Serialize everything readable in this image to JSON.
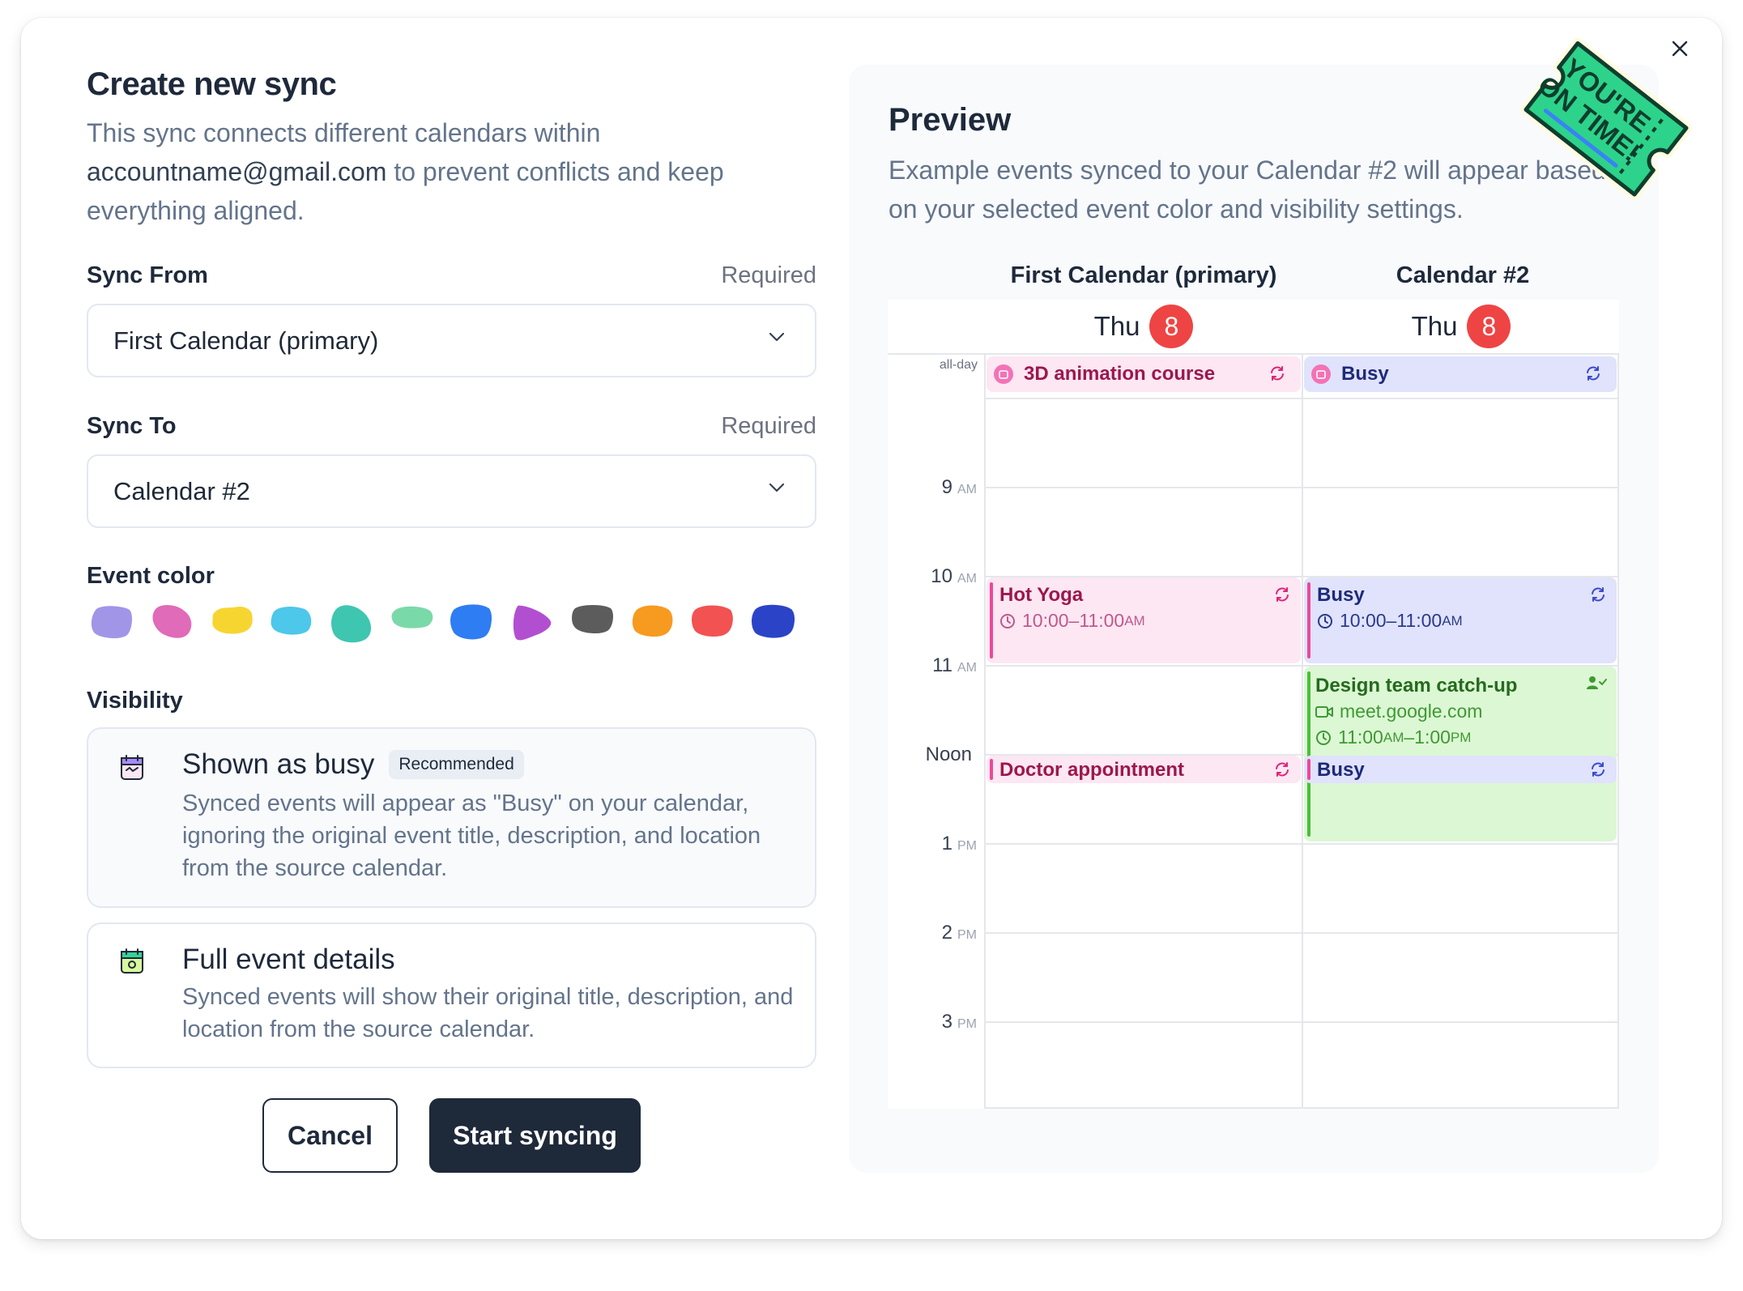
{
  "dialog": {
    "title": "Create new sync",
    "description_pre": "This sync connects different calendars within",
    "description_email": "accountname@gmail.com",
    "description_post": " to prevent conflicts and keep everything aligned.",
    "close_icon": "close-icon"
  },
  "sync_from": {
    "label": "Sync From",
    "required": "Required",
    "value": "First Calendar (primary)"
  },
  "sync_to": {
    "label": "Sync To",
    "required": "Required",
    "value": "Calendar #2"
  },
  "event_color": {
    "label": "Event color",
    "colors": [
      "#a195e8",
      "#e06bb8",
      "#f7d531",
      "#4dc7ea",
      "#3fc6b0",
      "#7ad9a8",
      "#2f7df2",
      "#b24fd1",
      "#5c5c5c",
      "#f79a20",
      "#f25252",
      "#2b44c7"
    ]
  },
  "visibility": {
    "label": "Visibility",
    "options": [
      {
        "title": "Shown as busy",
        "badge": "Recommended",
        "description": "Synced events will appear as \"Busy\" on your calendar, ignoring the original event title, description, and location from the source calendar.",
        "selected": true
      },
      {
        "title": "Full event details",
        "description": "Synced events will show their original title, description, and location from the source calendar.",
        "selected": false
      }
    ]
  },
  "buttons": {
    "cancel": "Cancel",
    "start": "Start syncing"
  },
  "preview": {
    "title": "Preview",
    "description": "Example events synced to your Calendar #2 will appear based on your selected event color and visibility settings.",
    "calendars": [
      {
        "name": "First Calendar (primary)",
        "day": "Thu",
        "date": "8"
      },
      {
        "name": "Calendar #2",
        "day": "Thu",
        "date": "8"
      }
    ],
    "all_day_label": "all-day",
    "times": [
      {
        "hour": "9",
        "suffix": "AM"
      },
      {
        "hour": "10",
        "suffix": "AM"
      },
      {
        "hour": "11",
        "suffix": "AM"
      },
      {
        "hour": "Noon",
        "suffix": ""
      },
      {
        "hour": "1",
        "suffix": "PM"
      },
      {
        "hour": "2",
        "suffix": "PM"
      },
      {
        "hour": "3",
        "suffix": "PM"
      }
    ],
    "events": {
      "animation": "3D animation course",
      "busy_allday": "Busy",
      "yoga": "Hot Yoga",
      "yoga_time": "10:00–11:00",
      "yoga_ampm": "AM",
      "busy_yoga": "Busy",
      "busy_yoga_time": "10:00–11:00",
      "busy_yoga_ampm": "AM",
      "design": "Design team catch-up",
      "design_link": "meet.google.com",
      "design_time_a": "11:00",
      "design_ampm_a": "AM",
      "design_time_b": "–1:00",
      "design_ampm_b": "PM",
      "doctor": "Doctor appointment",
      "busy_doctor": "Busy"
    },
    "sticker": {
      "line1": "YOU'RE",
      "line2": "ON TIME!"
    }
  }
}
